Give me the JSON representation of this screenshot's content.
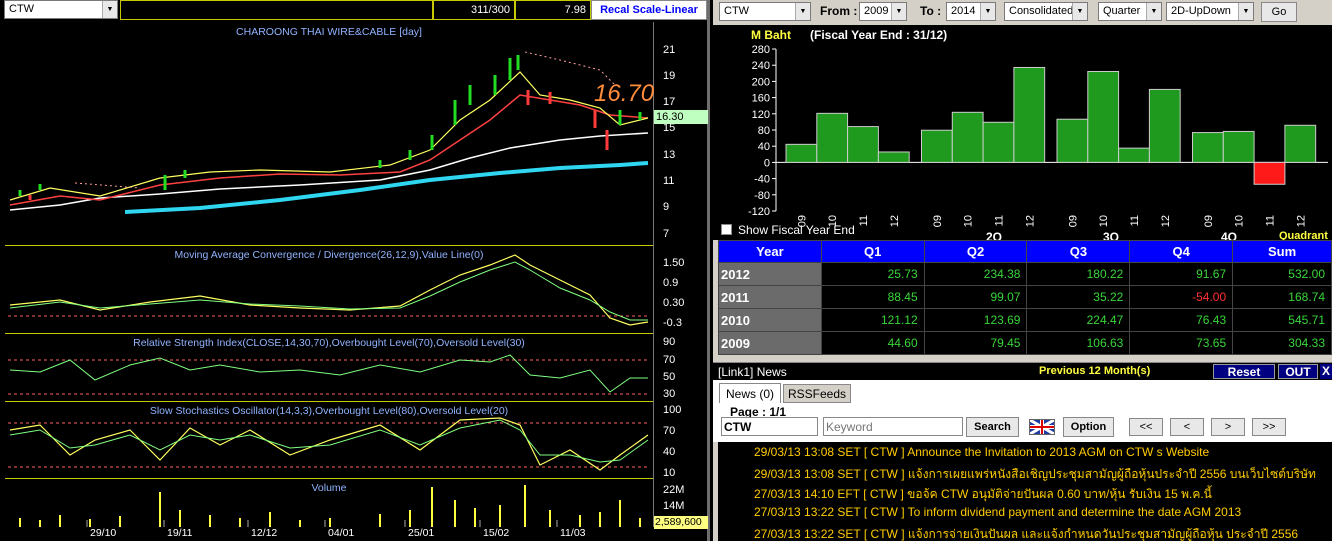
{
  "chart_toolbar": {
    "symbol": "CTW",
    "count": "311/300",
    "value": "7.98",
    "recal_label": "Recal Scale-Linear"
  },
  "chart_panels": {
    "price_title": "CHAROONG THAI WIRE&CABLE [day]",
    "price_ticks": [
      "21",
      "19",
      "17",
      "15",
      "13",
      "11",
      "9",
      "7"
    ],
    "last_price_big": "16.70",
    "last_price_tag": "16.30",
    "macd_title": "Moving Average Convergence / Divergence(26,12,9),Value Line(0)",
    "macd_ticks": [
      "1.50",
      "0.9",
      "0.30",
      "-0.3"
    ],
    "rsi_title": "Relative Strength Index(CLOSE,14,30,70),Overbought Level(70),Oversold Level(30)",
    "rsi_ticks": [
      "90",
      "70",
      "50",
      "30"
    ],
    "stoch_title": "Slow Stochastics Oscillator(14,3,3),Overbought Level(80),Oversold Level(20)",
    "stoch_ticks": [
      "100",
      "70",
      "40",
      "10"
    ],
    "volume_title": "Volume",
    "volume_ticks": [
      "22M",
      "14M"
    ],
    "volume_tag": "2,589,600",
    "dates": [
      "29/10",
      "19/11",
      "12/12",
      "04/01",
      "25/01",
      "15/02",
      "11/03"
    ]
  },
  "filter_bar": {
    "symbol": "CTW",
    "from_label": "From :",
    "from_value": "2009",
    "to_label": "To :",
    "to_value": "2014",
    "type_value": "Consolidated",
    "period_value": "Quarter",
    "view_value": "2D-UpDown",
    "go_label": "Go"
  },
  "fin_chart": {
    "unit": "M Baht",
    "fiscal": "(Fiscal Year End : 31/12)",
    "show_fiscal_label": "Show Fiscal Year End",
    "quadrant_label": "Quadrant",
    "group_labels": [
      "2Q",
      "3Q",
      "4Q"
    ],
    "bar_labels": [
      "09",
      "10",
      "11",
      "12",
      "09",
      "10",
      "11",
      "12",
      "09",
      "10",
      "11",
      "12",
      "09",
      "10",
      "11",
      "12"
    ]
  },
  "chart_data": {
    "type": "bar",
    "ylabel": "M Baht",
    "ylim": [
      -120,
      280
    ],
    "yticks": [
      280,
      240,
      200,
      160,
      120,
      80,
      40,
      0,
      -40,
      -80,
      -120
    ],
    "groups": [
      "Q1",
      "Q2",
      "Q3",
      "Q4"
    ],
    "years": [
      "2009",
      "2010",
      "2011",
      "2012"
    ],
    "series": [
      {
        "name": "Q1",
        "values": [
          44.6,
          121.12,
          88.45,
          25.73
        ]
      },
      {
        "name": "Q2",
        "values": [
          79.45,
          123.69,
          99.07,
          234.38
        ]
      },
      {
        "name": "Q3",
        "values": [
          106.63,
          224.47,
          35.22,
          180.22
        ]
      },
      {
        "name": "Q4",
        "values": [
          73.65,
          76.43,
          -54.0,
          91.67
        ]
      }
    ]
  },
  "fin_table": {
    "headers": [
      "Year",
      "Q1",
      "Q2",
      "Q3",
      "Q4",
      "Sum"
    ],
    "rows": [
      [
        "2012",
        "25.73",
        "234.38",
        "180.22",
        "91.67",
        "532.00"
      ],
      [
        "2011",
        "88.45",
        "99.07",
        "35.22",
        "-54.00",
        "168.74"
      ],
      [
        "2010",
        "121.12",
        "123.69",
        "224.47",
        "76.43",
        "545.71"
      ],
      [
        "2009",
        "44.60",
        "79.45",
        "106.63",
        "73.65",
        "304.33"
      ]
    ]
  },
  "news": {
    "header": "[Link1] News",
    "period": "Previous 12 Month(s)",
    "reset_label": "Reset",
    "out_label": "OUT",
    "close_label": "X",
    "tab_news": "News (0)",
    "tab_rss": "RSSFeeds",
    "page": "Page : 1/1",
    "symbol_value": "CTW",
    "keyword_placeholder": "Keyword",
    "search_label": "Search",
    "option_label": "Option",
    "nav": [
      "<<",
      "<",
      ">",
      ">>"
    ],
    "items": [
      "29/03/13 13:08  SET  [ CTW ]  Announce the Invitation to 2013 AGM on CTW s Website",
      "29/03/13 13:08  SET  [ CTW ]  แจ้งการเผยแพร่หนังสือเชิญประชุมสามัญผู้ถือหุ้นประจำปี 2556 บนเว็บไซต์บริษัท",
      "27/03/13 14:10  EFT  [ CTW ]  ขอจ้ค CTW อนุมัติจ่ายปันผล 0.60 บาท/หุ้น รับเงิน 15 พ.ค.นี้",
      "27/03/13 13:22  SET  [ CTW ]  To inform dividend payment and determine the date AGM 2013",
      "27/03/13 13:22  SET  [ CTW ]  แจ้งการจ่ายเงินปันผล และแจ้งกำหนดวันประชุมสามัญผู้ถือหุ้น ประจำปี 2556"
    ]
  }
}
